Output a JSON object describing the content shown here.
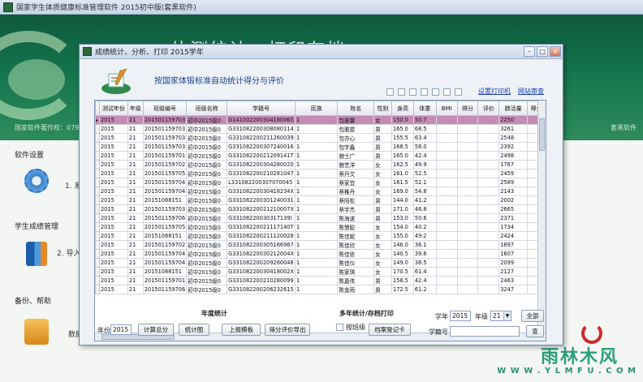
{
  "main_window": {
    "title": "国家学生体质健康标准管理软件 2015初中版(套黑软件)",
    "banner_heading": "体测统计、打印存档",
    "footer_left": "国家软件著作权：07942487",
    "footer_right": "套黑软件"
  },
  "side_menu": {
    "system_settings": "软件设置",
    "item1": "1. 系",
    "student_grades": "学生成绩管理",
    "item2": "2. 导入",
    "backup_help": "备份、帮助",
    "item3": "数据"
  },
  "watermark": {
    "name": "雨林木风",
    "url": "W W W . Y L M F U . C O M"
  },
  "dialog": {
    "title": "成绩统计、分析、打印   2015学年",
    "heading": "按国家体锻标准自动统计得分与评价",
    "link_print_setup": "设置打印机",
    "link_website": "网站审查"
  },
  "grid": {
    "columns": [
      "测试年份",
      "年级",
      "班级编号",
      "班级名称",
      "学籍号",
      "民族",
      "姓名",
      "性别",
      "身高",
      "体重",
      "BMI",
      "得分",
      "评价",
      "肺活量",
      "得分"
    ],
    "rows": [
      [
        "2015",
        "21",
        "201501159703",
        "初中2015级0",
        "G141002200304180065",
        "1",
        "包雅馨",
        "女",
        "150.0",
        "50.7",
        "",
        "",
        "",
        "2250",
        ""
      ],
      [
        "2015",
        "21",
        "201501159703",
        "初中2015级0",
        "G331082200308080114",
        "1",
        "包雅霆",
        "男",
        "165.0",
        "68.5",
        "",
        "",
        "",
        "3261",
        ""
      ],
      [
        "2015",
        "21",
        "201501159703",
        "初中2015级0",
        "G331082200211260039",
        "1",
        "包亦心",
        "男",
        "155.5",
        "63.4",
        "",
        "",
        "",
        "2548",
        ""
      ],
      [
        "2015",
        "21",
        "201501159703",
        "初中2015级0",
        "G331082200307240016",
        "1",
        "包宇鑫",
        "男",
        "168.5",
        "58.0",
        "",
        "",
        "",
        "2392",
        ""
      ],
      [
        "2015",
        "21",
        "201501159701",
        "初中2015级0",
        "G33108220021209141T",
        "1",
        "鲍士广",
        "男",
        "165.0",
        "42.4",
        "",
        "",
        "",
        "2498",
        ""
      ],
      [
        "2015",
        "21",
        "201501159702",
        "初中2015级0",
        "G331082200304280020",
        "1",
        "鲍艺洋",
        "女",
        "162.5",
        "49.9",
        "",
        "",
        "",
        "1767",
        ""
      ],
      [
        "2015",
        "21",
        "201501159705",
        "初中2015级0",
        "G331082200210281047",
        "1",
        "蔡丹文",
        "女",
        "161.0",
        "52.5",
        "",
        "",
        "",
        "2459",
        ""
      ],
      [
        "2015",
        "21",
        "201501159704",
        "初中2015级0",
        "L331082200307070045",
        "1",
        "蔡家宜",
        "女",
        "161.5",
        "52.1",
        "",
        "",
        "",
        "2589",
        ""
      ],
      [
        "2015",
        "21",
        "201501159704",
        "初中2015级0",
        "G33108220030418234X",
        "1",
        "蔡稚丹",
        "女",
        "169.0",
        "54.8",
        "",
        "",
        "",
        "2143",
        ""
      ],
      [
        "2015",
        "21",
        "20151088151",
        "初中2015级0",
        "G331082200301240031",
        "1",
        "蔡阳松",
        "男",
        "144.0",
        "41.2",
        "",
        "",
        "",
        "2002",
        ""
      ],
      [
        "2015",
        "21",
        "201501159703",
        "初中2015级0",
        "G33108220021210007X",
        "1",
        "蔡宇杰",
        "男",
        "171.0",
        "46.8",
        "",
        "",
        "",
        "2665",
        ""
      ],
      [
        "2015",
        "21",
        "201501159706",
        "初中2015级0",
        "G33108220030317139I",
        "1",
        "陈海波",
        "男",
        "153.0",
        "50.6",
        "",
        "",
        "",
        "2371",
        ""
      ],
      [
        "2015",
        "21",
        "201501159705",
        "初中2015级0",
        "G33108220021117140T",
        "1",
        "陈慧聪",
        "女",
        "154.0",
        "40.2",
        "",
        "",
        "",
        "1734",
        ""
      ],
      [
        "2015",
        "21",
        "20151088151",
        "初中2015级0",
        "G331082200211120028",
        "1",
        "陈佳妮",
        "女",
        "155.0",
        "49.2",
        "",
        "",
        "",
        "2424",
        ""
      ],
      [
        "2015",
        "21",
        "201501159702",
        "初中2015级0",
        "G331082200305166967",
        "1",
        "陈佳欣",
        "女",
        "146.0",
        "36.1",
        "",
        "",
        "",
        "1897",
        ""
      ],
      [
        "2015",
        "21",
        "201501159704",
        "初中2015级0",
        "G33108220030212004X",
        "1",
        "陈佳依",
        "女",
        "140.5",
        "39.6",
        "",
        "",
        "",
        "1607",
        ""
      ],
      [
        "2015",
        "21",
        "201501159704",
        "初中2015级0",
        "G331082200209260048",
        "1",
        "陈佳仪",
        "女",
        "149.0",
        "38.5",
        "",
        "",
        "",
        "2099",
        ""
      ],
      [
        "2015",
        "21",
        "20151088151",
        "初中2015级0",
        "G33108220030418002X",
        "1",
        "陈家琪",
        "女",
        "170.5",
        "61.4",
        "",
        "",
        "",
        "2127",
        ""
      ],
      [
        "2015",
        "21",
        "201501159701",
        "初中2015级0",
        "G331082200210280099",
        "1",
        "陈嘉伟",
        "男",
        "158.5",
        "42.4",
        "",
        "",
        "",
        "2463",
        ""
      ],
      [
        "2015",
        "21",
        "201501159706",
        "初中2015级0",
        "G331082200206232615",
        "1",
        "陈金雨",
        "男",
        "172.5",
        "61.2",
        "",
        "",
        "",
        "3247",
        ""
      ]
    ]
  },
  "bottom": {
    "annual_stats_label": "年度统计",
    "year_label": "年份",
    "year_value": "2015",
    "btn_calc": "计算总分",
    "btn_chart": "统计图",
    "btn_report": "上报模板",
    "btn_export": "得分评价导出",
    "multi_year_label": "多年统计/存档打印",
    "by_class_label": "按班级",
    "btn_archive": "档案登记卡",
    "school_year_label": "学年",
    "school_year_value": "2015",
    "grade_label": "年级",
    "grade_value": "21",
    "btn_all": "全部",
    "student_id_label": "学籍号",
    "student_id_value": "",
    "btn_search": "查"
  }
}
